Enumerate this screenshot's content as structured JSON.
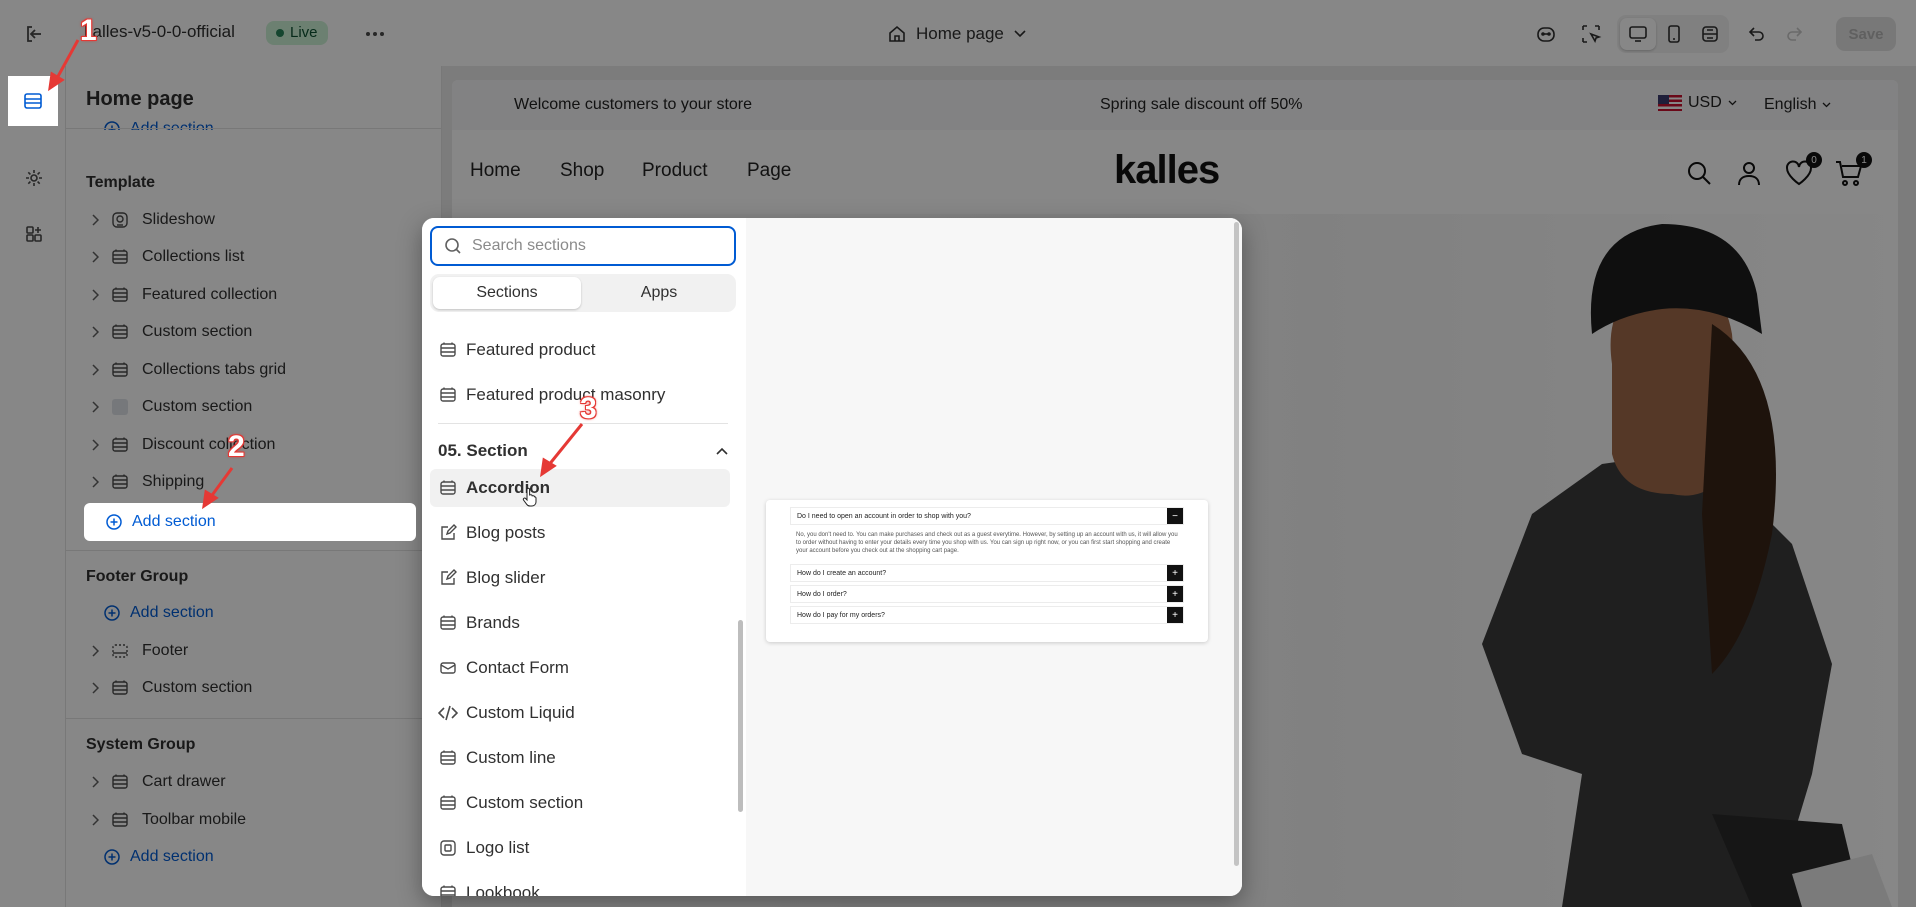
{
  "topbar": {
    "store_name": "kalles-v5-0-0-official",
    "live_badge": "Live",
    "page_picker": "Home page",
    "save_label": "Save"
  },
  "sidebar": {
    "title": "Home page",
    "top_add_section": "Add section",
    "groups": [
      {
        "title": "Template",
        "items": [
          {
            "label": "Slideshow",
            "icon": "slideshow-icon"
          },
          {
            "label": "Collections list",
            "icon": "section-icon"
          },
          {
            "label": "Featured collection",
            "icon": "section-icon"
          },
          {
            "label": "Custom section",
            "icon": "section-icon"
          },
          {
            "label": "Collections tabs grid",
            "icon": "section-icon"
          },
          {
            "label": "Custom section",
            "icon": "swatch"
          },
          {
            "label": "Discount collection",
            "icon": "section-icon"
          },
          {
            "label": "Shipping",
            "icon": "section-icon"
          }
        ],
        "add_label": "Add section"
      },
      {
        "title": "Footer Group",
        "add_label": "Add section",
        "items": [
          {
            "label": "Footer",
            "icon": "footer-icon"
          },
          {
            "label": "Custom section",
            "icon": "section-icon"
          }
        ]
      },
      {
        "title": "System Group",
        "items": [
          {
            "label": "Cart drawer",
            "icon": "section-icon"
          },
          {
            "label": "Toolbar mobile",
            "icon": "section-icon"
          }
        ],
        "add_label": "Add section"
      }
    ]
  },
  "preview": {
    "announcement_left": "Welcome customers to your store",
    "announcement_center": "Spring sale discount off 50%",
    "currency": "USD",
    "language": "English",
    "nav": [
      "Home",
      "Shop",
      "Product",
      "Page"
    ],
    "logo": "kalles",
    "wishlist_count": "0",
    "cart_count": "1"
  },
  "picker": {
    "search_placeholder": "Search sections",
    "tabs": [
      "Sections",
      "Apps"
    ],
    "items_before": [
      {
        "label": "Featured product",
        "icon": "section-icon"
      },
      {
        "label": "Featured product masonry",
        "icon": "section-icon"
      }
    ],
    "group_title": "05. Section",
    "items": [
      {
        "label": "Accordion",
        "icon": "section-icon"
      },
      {
        "label": "Blog posts",
        "icon": "blog-icon"
      },
      {
        "label": "Blog slider",
        "icon": "blog-icon"
      },
      {
        "label": "Brands",
        "icon": "section-icon"
      },
      {
        "label": "Contact Form",
        "icon": "email-icon"
      },
      {
        "label": "Custom Liquid",
        "icon": "code-icon"
      },
      {
        "label": "Custom line",
        "icon": "section-icon"
      },
      {
        "label": "Custom section",
        "icon": "section-icon"
      },
      {
        "label": "Logo list",
        "icon": "logo-list-icon"
      },
      {
        "label": "Lookbook",
        "icon": "section-icon"
      }
    ],
    "accordion_preview": {
      "q1": "Do I need to open an account in order to shop with you?",
      "a1": "No, you don't need to. You can make purchases and check out as a guest everytime. However, by setting up an account with us, it will allow you to order without having to enter your details every time you shop with us. You can sign up right now, or you can first start shopping and create your account before you check out at the shopping cart page.",
      "q2": "How do I create an account?",
      "q3": "How do I order?",
      "q4": "How do I pay for my orders?"
    }
  },
  "annotations": [
    "1",
    "2",
    "3"
  ],
  "colors": {
    "accent": "#005bd3",
    "annotation": "#e53935",
    "live": "#29845a"
  }
}
